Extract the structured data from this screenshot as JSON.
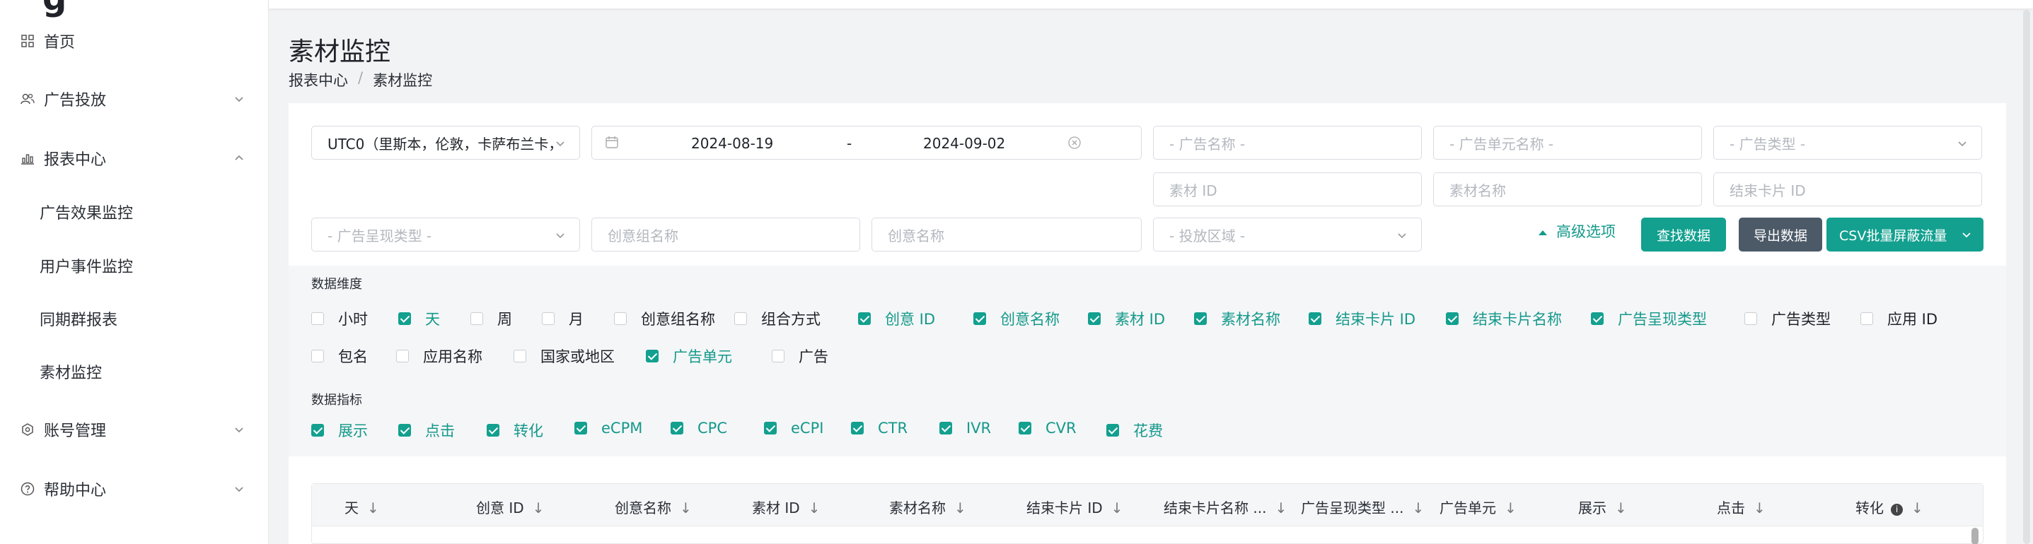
{
  "sidebar": {
    "logo_fragment": "g",
    "items": [
      {
        "label": "首页",
        "icon": "grid-icon"
      },
      {
        "label": "广告投放",
        "icon": "users-icon"
      },
      {
        "label": "报表中心",
        "icon": "chart-icon"
      },
      {
        "label": "账号管理",
        "icon": "gear-icon"
      },
      {
        "label": "帮助中心",
        "icon": "help-icon"
      }
    ],
    "report_children": [
      "广告效果监控",
      "用户事件监控",
      "同期群报表",
      "素材监控"
    ]
  },
  "header": {
    "title": "素材监控",
    "breadcrumb": [
      "报表中心",
      "/",
      "素材监控"
    ]
  },
  "filters": {
    "timezone": "UTC0（里斯本，伦敦，卡萨布兰卡，",
    "date_start": "2024-08-19",
    "date_sep": "-",
    "date_end": "2024-09-02",
    "ad_name_placeholder": "- 广告名称 -",
    "adunit_name_placeholder": "- 广告单元名称 -",
    "ad_type_placeholder": "- 广告类型 -",
    "asset_id_placeholder": "素材 ID",
    "asset_name_placeholder": "素材名称",
    "endcard_id_placeholder": "结束卡片 ID",
    "display_type_placeholder": "- 广告呈现类型 -",
    "creative_group_placeholder": "创意组名称",
    "creative_name_placeholder": "创意名称",
    "region_placeholder": "- 投放区域 -",
    "advanced_label": "高级选项",
    "search_button": "查找数据",
    "export_button": "导出数据",
    "csv_button": "CSV批量屏蔽流量"
  },
  "dimensions": {
    "label": "数据维度",
    "row1": [
      {
        "label": "小时",
        "checked": false
      },
      {
        "label": "天",
        "checked": true
      },
      {
        "label": "周",
        "checked": false
      },
      {
        "label": "月",
        "checked": false
      },
      {
        "label": "创意组名称",
        "checked": false
      },
      {
        "label": "组合方式",
        "checked": false
      },
      {
        "label": "创意 ID",
        "checked": true
      },
      {
        "label": "创意名称",
        "checked": true
      },
      {
        "label": "素材 ID",
        "checked": true
      },
      {
        "label": "素材名称",
        "checked": true
      },
      {
        "label": "结束卡片 ID",
        "checked": true
      },
      {
        "label": "结束卡片名称",
        "checked": true
      },
      {
        "label": "广告呈现类型",
        "checked": true
      },
      {
        "label": "广告类型",
        "checked": false
      },
      {
        "label": "应用 ID",
        "checked": false
      }
    ],
    "row2": [
      {
        "label": "包名",
        "checked": false
      },
      {
        "label": "应用名称",
        "checked": false
      },
      {
        "label": "国家或地区",
        "checked": false
      },
      {
        "label": "广告单元",
        "checked": true
      },
      {
        "label": "广告",
        "checked": false
      }
    ]
  },
  "metrics": {
    "label": "数据指标",
    "items": [
      {
        "label": "展示",
        "checked": true
      },
      {
        "label": "点击",
        "checked": true
      },
      {
        "label": "转化",
        "checked": true
      },
      {
        "label": "eCPM",
        "checked": true
      },
      {
        "label": "CPC",
        "checked": true
      },
      {
        "label": "eCPI",
        "checked": true
      },
      {
        "label": "CTR",
        "checked": true
      },
      {
        "label": "IVR",
        "checked": true
      },
      {
        "label": "CVR",
        "checked": true
      },
      {
        "label": "花费",
        "checked": true
      }
    ]
  },
  "table": {
    "columns": [
      "天",
      "创意 ID",
      "创意名称",
      "素材 ID",
      "素材名称",
      "结束卡片 ID",
      "结束卡片名称 ...",
      "广告呈现类型 ...",
      "广告单元",
      "展示",
      "点击",
      "转化"
    ],
    "sort_glyph": "↓",
    "info_glyph": "i"
  },
  "colors": {
    "accent": "#13a08f",
    "dark_button": "#4c5a68"
  }
}
